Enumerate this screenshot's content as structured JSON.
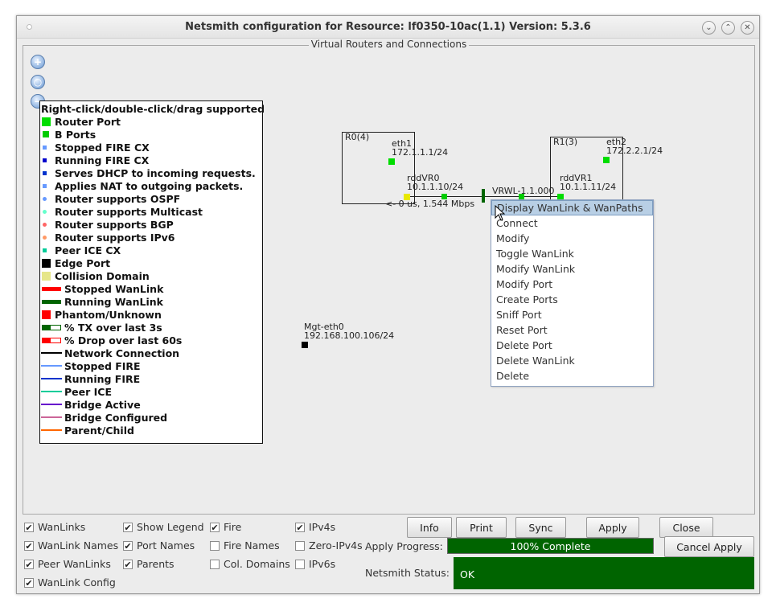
{
  "window": {
    "title": "Netsmith configuration for Resource:  lf0350-10ac(1.1)  Version: 5.3.6",
    "controls": {
      "minimize": "⌄",
      "maximize": "⌃",
      "close": "✕"
    }
  },
  "canvas": {
    "title": "Virtual Routers and Connections",
    "zoom_buttons": [
      {
        "name": "zoom-in",
        "glyph": "+"
      },
      {
        "name": "zoom-reset",
        "glyph": "○"
      },
      {
        "name": "zoom-out",
        "glyph": "−"
      }
    ]
  },
  "legend": {
    "title": "Right-click/double-click/drag supported",
    "items": [
      {
        "label": "Router Port",
        "swatch": "big-square",
        "color": "#00dd00"
      },
      {
        "label": "B Ports",
        "swatch": "square",
        "color": "#00cc00"
      },
      {
        "label": "Stopped FIRE CX",
        "swatch": "small-square",
        "color": "#6699ff"
      },
      {
        "label": "Running FIRE CX",
        "swatch": "small-square",
        "color": "#0000cc"
      },
      {
        "label": "Serves DHCP to incoming requests.",
        "swatch": "small-square",
        "color": "#0033cc"
      },
      {
        "label": "Applies NAT to outgoing packets.",
        "swatch": "small-square",
        "color": "#6699ff"
      },
      {
        "label": "Router supports OSPF",
        "swatch": "dot",
        "color": "#6699ff"
      },
      {
        "label": "Router supports Multicast",
        "swatch": "dot",
        "color": "#66ffcc"
      },
      {
        "label": "Router supports BGP",
        "swatch": "dot",
        "color": "#ff6666"
      },
      {
        "label": "Router supports IPv6",
        "swatch": "dot",
        "color": "#ff9966"
      },
      {
        "label": "Peer ICE CX",
        "swatch": "small-square",
        "color": "#00cc99"
      },
      {
        "label": "Edge Port",
        "swatch": "big-square",
        "color": "#000000"
      },
      {
        "label": "Collision Domain",
        "swatch": "big-square",
        "color": "#e6e68a"
      },
      {
        "label": "Stopped WanLink",
        "swatch": "bar",
        "color": "#ff0000"
      },
      {
        "label": "Running WanLink",
        "swatch": "bar",
        "color": "#006400"
      },
      {
        "label": "Phantom/Unknown",
        "swatch": "big-square",
        "color": "#ff0000"
      },
      {
        "label": "% TX over last 3s",
        "swatch": "outline-bar",
        "color": "#006400"
      },
      {
        "label": "% Drop over last 60s",
        "swatch": "outline-bar",
        "color": "#ff0000"
      },
      {
        "label": "Network Connection",
        "swatch": "line",
        "color": "#000000"
      },
      {
        "label": "Stopped FIRE",
        "swatch": "line",
        "color": "#6699ff"
      },
      {
        "label": "Running FIRE",
        "swatch": "line",
        "color": "#0033cc"
      },
      {
        "label": "Peer ICE",
        "swatch": "line",
        "color": "#00cc99"
      },
      {
        "label": "Bridge Active",
        "swatch": "line",
        "color": "#6600cc"
      },
      {
        "label": "Bridge Configured",
        "swatch": "line",
        "color": "#cc6699"
      },
      {
        "label": "Parent/Child",
        "swatch": "line",
        "color": "#ff6600"
      }
    ]
  },
  "topology": {
    "routers": [
      {
        "name": "R0(4)",
        "port_name": "eth1",
        "port_ip": "172.1.1.1/24",
        "rdd_name": "rddVR0",
        "rdd_ip": "10.1.1.10/24"
      },
      {
        "name": "R1(3)",
        "port_name": "eth2",
        "port_ip": "172.2.2.1/24",
        "rdd_name": "rddVR1",
        "rdd_ip": "10.1.1.11/24"
      }
    ],
    "wanlink": {
      "name": "VRWL-1.1.000",
      "stats": "<- 0 us, 1.544 Mbps"
    },
    "edge_port": {
      "name": "Mgt-eth0",
      "ip": "192.168.100.106/24"
    }
  },
  "context_menu": {
    "items": [
      "Display WanLink & WanPaths",
      "Connect",
      "Modify",
      "Toggle WanLink",
      "Modify WanLink",
      "Modify Port",
      "Create Ports",
      "Sniff Port",
      "Reset Port",
      "Delete Port",
      "Delete WanLink",
      "Delete"
    ],
    "selected_index": 0
  },
  "options": {
    "checkboxes": [
      {
        "label": "WanLinks",
        "checked": true
      },
      {
        "label": "WanLink Names",
        "checked": true
      },
      {
        "label": "Peer WanLinks",
        "checked": true
      },
      {
        "label": "WanLink Config",
        "checked": true
      },
      {
        "label": "Show Legend",
        "checked": true
      },
      {
        "label": "Port Names",
        "checked": true
      },
      {
        "label": "Parents",
        "checked": true
      },
      {
        "label": "Fire",
        "checked": true
      },
      {
        "label": "Fire Names",
        "checked": false
      },
      {
        "label": "Col. Domains",
        "checked": false
      },
      {
        "label": "IPv4s",
        "checked": true
      },
      {
        "label": "Zero-IPv4s",
        "checked": false
      },
      {
        "label": "IPv6s",
        "checked": false
      }
    ]
  },
  "buttons": {
    "info": "Info",
    "print": "Print",
    "sync": "Sync",
    "apply": "Apply",
    "close": "Close",
    "cancel_apply": "Cancel Apply"
  },
  "apply_progress": {
    "label": "Apply Progress:",
    "percent": 100,
    "text": "100% Complete"
  },
  "netsmith_status": {
    "label": "Netsmith Status:",
    "value": "OK"
  },
  "colors": {
    "status_green": "#006400",
    "port_green": "#00dd00",
    "rdd_yellow": "#e8e800",
    "menu_selected": "#b8cfe5"
  }
}
